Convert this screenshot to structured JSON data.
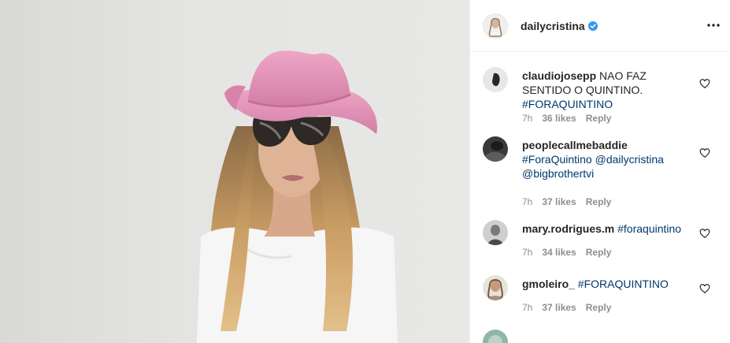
{
  "post": {
    "username": "dailycristina",
    "verified_icon": "verified-badge-icon",
    "options_icon": "more-options-icon"
  },
  "comments": [
    {
      "user": "claudiojosepp",
      "text": "NAO FAZ SENTIDO O QUINTINO.",
      "tags": [
        "#FORAQUINTINO"
      ],
      "time": "7h",
      "likes": "36 likes",
      "reply": "Reply"
    },
    {
      "user": "peoplecallmebaddie",
      "text": "",
      "tags": [
        "#ForaQuintino",
        "@dailycristina",
        "@bigbrothertvi"
      ],
      "time": "7h",
      "likes": "37 likes",
      "reply": "Reply"
    },
    {
      "user": "mary.rodrigues.m",
      "text": "",
      "tags": [
        "#foraquintino"
      ],
      "time": "7h",
      "likes": "34 likes",
      "reply": "Reply"
    },
    {
      "user": "gmoleiro_",
      "text": "",
      "tags": [
        "#FORAQUINTINO"
      ],
      "time": "7h",
      "likes": "37 likes",
      "reply": "Reply"
    }
  ],
  "colors": {
    "hat": "#e48fb5",
    "verified": "#3897f0",
    "link": "#00376b"
  }
}
